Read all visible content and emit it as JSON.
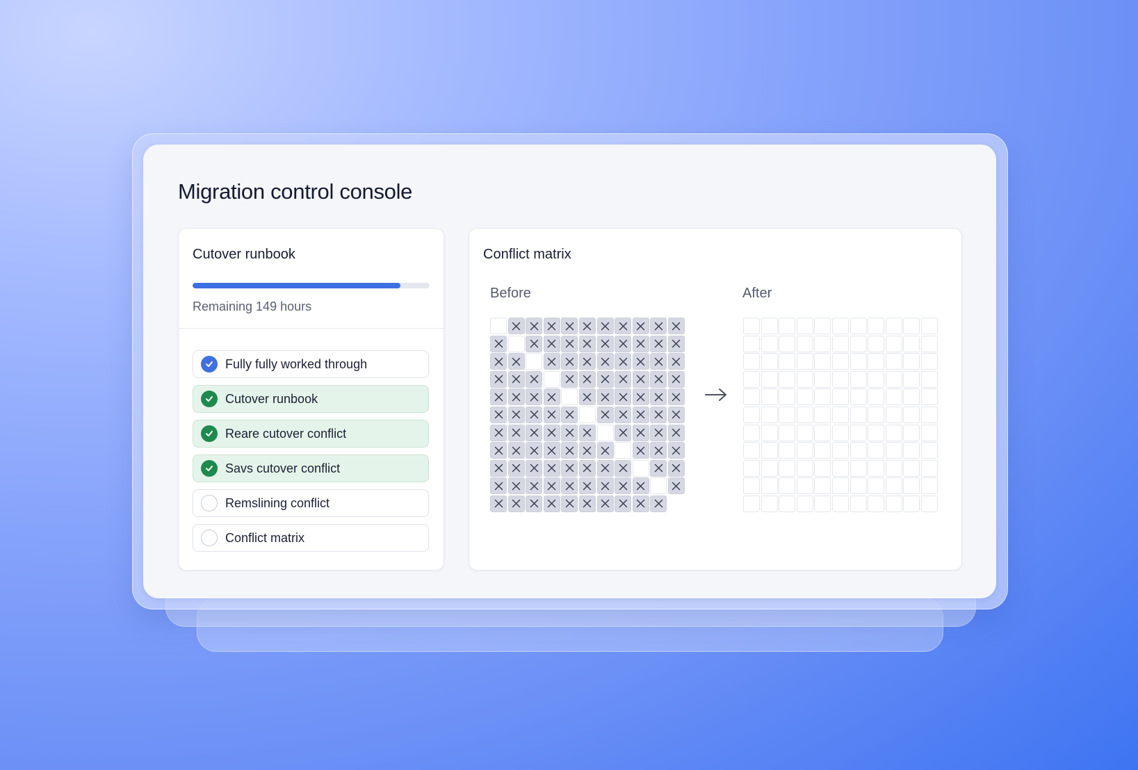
{
  "window": {
    "title": "Migration control console"
  },
  "runbook": {
    "title": "Cutover runbook",
    "progress_fraction": 0.878,
    "remaining_text": "Remaining 149 hours",
    "steps": [
      {
        "label": "Fully fully worked through",
        "status": "current",
        "icon": "check-circle-blue-icon"
      },
      {
        "label": "Cutover runbook",
        "status": "done",
        "icon": "check-circle-green-icon"
      },
      {
        "label": "Reare cutover conflict",
        "status": "done",
        "icon": "check-circle-green-icon"
      },
      {
        "label": "Savs cutover conflict",
        "status": "done",
        "icon": "check-circle-green-icon"
      },
      {
        "label": "Remslining conflict",
        "status": "pending",
        "icon": "empty-circle-icon"
      },
      {
        "label": "Conflict matrix",
        "status": "pending",
        "icon": "empty-circle-icon"
      }
    ]
  },
  "matrix": {
    "title": "Conflict matrix",
    "before_label": "Before",
    "after_label": "After",
    "arrow_icon": "arrow-right-icon",
    "before_grid": [
      "oxxxxxxxxxx",
      "xoxxxxxxxxx",
      "xxoxxxxxxxx",
      "xxxoxxxxxxx",
      "xxxxoxxxxxx",
      "xxxxxoxxxxx",
      "xxxxxxoxxxx",
      "xxxxxxxoxxx",
      "xxxxxxxxoxx",
      "xxxxxxxxxox",
      "xxxxxxxxxx-"
    ],
    "after_grid": [
      "ooooooooooo",
      "ooooooooooo",
      "ooooooooooo",
      "ooooooooooo",
      "ooooooooooo",
      "ooooooooooo",
      "ooooooooooo",
      "ooooooooooo",
      "ooooooooooo",
      "ooooooooooo",
      "ooooooooooo"
    ],
    "colors": {
      "conflict_cell": "#d5d8e2",
      "open_cell": "#ffffff",
      "mark": "#3a3f52"
    }
  },
  "colors": {
    "accent_blue": "#3d6fe3",
    "success_green": "#1e8a4d",
    "done_row_bg": "#e5f4ea"
  }
}
